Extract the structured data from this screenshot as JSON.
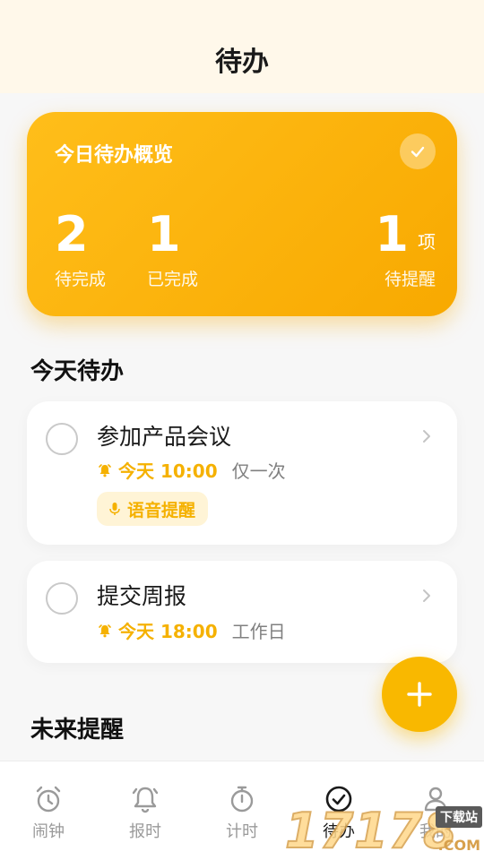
{
  "header": {
    "title": "待办"
  },
  "summary": {
    "title": "今日待办概览",
    "pending_count": "2",
    "pending_label": "待完成",
    "done_count": "1",
    "done_label": "已完成",
    "reminder_count": "1",
    "reminder_unit": "项",
    "reminder_label": "待提醒"
  },
  "today": {
    "section_title": "今天待办",
    "items": [
      {
        "title": "参加产品会议",
        "time": "今天 10:00",
        "repeat": "仅一次",
        "tag": "语音提醒"
      },
      {
        "title": "提交周报",
        "time": "今天 18:00",
        "repeat": "工作日"
      }
    ]
  },
  "future": {
    "section_title": "未来提醒"
  },
  "tabs": [
    {
      "label": "闹钟",
      "icon": "alarm-clock-icon"
    },
    {
      "label": "报时",
      "icon": "bell-icon"
    },
    {
      "label": "计时",
      "icon": "stopwatch-icon"
    },
    {
      "label": "待办",
      "icon": "check-circle-icon",
      "active": true
    },
    {
      "label": "我的",
      "icon": "user-icon"
    }
  ],
  "watermark": {
    "text": "17178",
    "tag": "下载站",
    "suffix": ".COM"
  },
  "colors": {
    "accent": "#f9b800",
    "accent_light": "#fff4d6",
    "header_bg": "#fff8ea"
  }
}
